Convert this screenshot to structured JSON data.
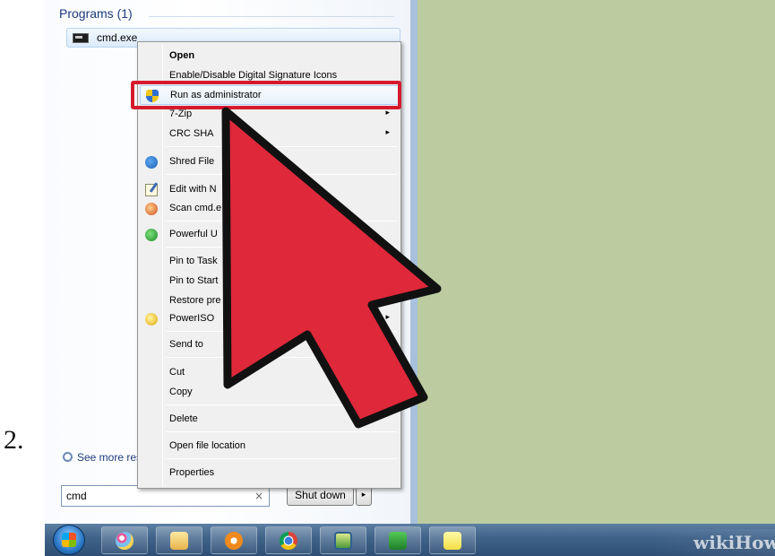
{
  "step_number": "2.",
  "start_menu": {
    "programs_header": "Programs (1)",
    "program_item": {
      "label": "cmd.exe",
      "icon": "cmd-icon"
    },
    "see_more": "See more res",
    "search": {
      "value": "cmd",
      "clear": "×"
    },
    "shutdown": {
      "label": "Shut down",
      "arrow": "▸"
    }
  },
  "context_menu": {
    "items": [
      {
        "label": "Open",
        "bold": true
      },
      {
        "label": "Enable/Disable Digital Signature Icons"
      },
      {
        "label": "Run as administrator",
        "icon": "uac-shield-icon",
        "highlighted": true
      },
      {
        "label": "7-Zip",
        "submenu": true
      },
      {
        "label": "CRC SHA",
        "submenu": true
      },
      {
        "label": "Shred File",
        "icon": "shred-icon"
      },
      {
        "label": "Edit with N",
        "icon": "notepad-icon"
      },
      {
        "label": "Scan cmd.e",
        "icon": "scan-icon"
      },
      {
        "label": "Powerful U",
        "icon": "uninstaller-icon"
      },
      {
        "label": "Pin to Task"
      },
      {
        "label": "Pin to Start"
      },
      {
        "label": "Restore pre"
      },
      {
        "label": "PowerISO",
        "icon": "poweriso-icon",
        "submenu": true
      },
      {
        "label": "Send to",
        "submenu": true
      },
      {
        "label": "Cut"
      },
      {
        "label": "Copy"
      },
      {
        "label": "Delete"
      },
      {
        "label": "Open file location"
      },
      {
        "label": "Properties"
      }
    ],
    "submenu_glyph": "▸"
  },
  "taskbar": {
    "items": [
      "start-orb",
      "paint-icon",
      "explorer-icon",
      "media-player-icon",
      "chrome-icon",
      "app-icon",
      "camtasia-icon",
      "sticky-notes-icon"
    ]
  },
  "watermark": "wikiHow",
  "colors": {
    "highlight_border": "#d61a2e",
    "arrow_fill": "#e0283b",
    "desktop": "#bccca0"
  }
}
